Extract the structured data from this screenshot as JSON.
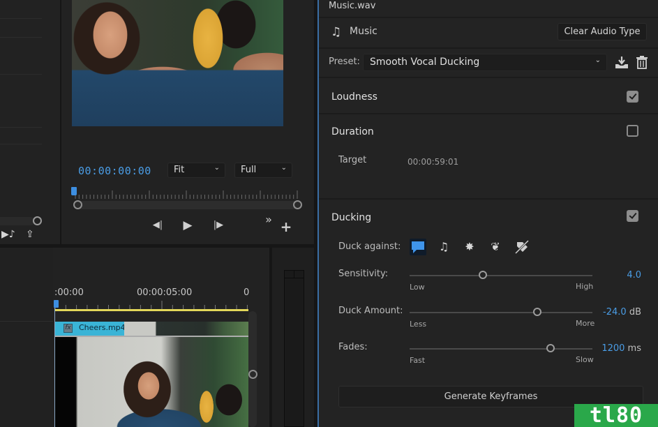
{
  "program_monitor": {
    "timecode": "00:00:00:00",
    "zoom_select": {
      "value": "Fit"
    },
    "resolution_select": {
      "value": "Full"
    },
    "image_description": "Woman smiling while clinking beer glasses",
    "playhead_position_fraction": 0.0,
    "transport": {
      "step_back_icon": "◀|",
      "play_icon": "▶",
      "step_forward_icon": "|▶",
      "more_icon": "»",
      "add_icon": "+"
    }
  },
  "project_panel": {
    "icons": {
      "automate_icon": "▶♪",
      "export_icon": "⇪"
    }
  },
  "timeline": {
    "time_labels": [
      ":00:00",
      "00:00:05:00",
      "0"
    ],
    "clip": {
      "fx_label": "fx",
      "name": "Cheers.mp4"
    }
  },
  "essential_sound": {
    "file_name": "Music.wav",
    "audio_type": {
      "icon": "♫",
      "label": "Music",
      "clear_button": "Clear Audio Type"
    },
    "preset": {
      "label": "Preset:",
      "value": "Smooth Vocal Ducking",
      "save_icon": "⤓",
      "delete_icon": "🗑"
    },
    "sections": {
      "loudness": {
        "title": "Loudness",
        "checked": true
      },
      "duration": {
        "title": "Duration",
        "checked": false,
        "target_label": "Target",
        "target_value": "00:00:59:01"
      },
      "ducking": {
        "title": "Ducking",
        "checked": true,
        "duck_against_label": "Duck against:",
        "duck_against_options": [
          {
            "name": "dialogue",
            "icon": "💬",
            "active": true
          },
          {
            "name": "music",
            "icon": "♫",
            "active": false
          },
          {
            "name": "sfx",
            "icon": "✸",
            "active": false
          },
          {
            "name": "ambience",
            "icon": "❦",
            "active": false
          },
          {
            "name": "untagged",
            "icon": "⊘",
            "active": false
          }
        ],
        "sliders": [
          {
            "label": "Sensitivity:",
            "min_label": "Low",
            "max_label": "High",
            "value": "4.0",
            "unit": "",
            "fraction": 0.4
          },
          {
            "label": "Duck Amount:",
            "min_label": "Less",
            "max_label": "More",
            "value": "-24.0",
            "unit": " dB",
            "fraction": 0.7
          },
          {
            "label": "Fades:",
            "min_label": "Fast",
            "max_label": "Slow",
            "value": "1200",
            "unit": " ms",
            "fraction": 0.77
          }
        ],
        "generate_button": "Generate Keyframes"
      }
    }
  },
  "watermark": {
    "text": "tl80"
  },
  "colors": {
    "accent": "#4a9de6",
    "clip": "#3ab4d6",
    "workarea": "#e3d75a",
    "watermark": "#2aa84a"
  }
}
